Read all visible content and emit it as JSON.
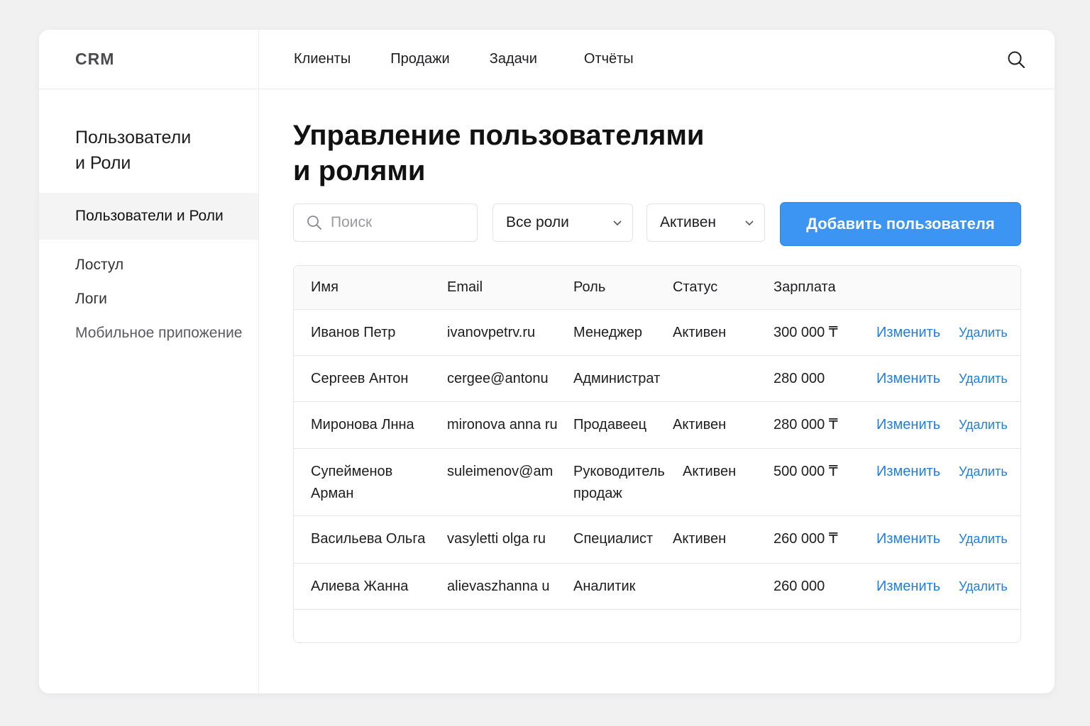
{
  "app": {
    "brand": "CRM"
  },
  "sidebar": {
    "heading_line1": "Пользователи",
    "heading_line2": "и Роли",
    "items": [
      {
        "label": "Пользователи и Роли",
        "active": true
      },
      {
        "label": "Лостул"
      },
      {
        "label": "Логи"
      },
      {
        "label": "Мобильное припожение"
      }
    ]
  },
  "topnav": {
    "links": [
      "Клиенты",
      "Продажи",
      "Задачи",
      "Отчёты"
    ],
    "search_icon": "search-icon"
  },
  "page": {
    "title_line1": "Управление пользователями",
    "title_line2": "и ролями"
  },
  "toolbar": {
    "search_placeholder": "Поиск",
    "role_filter": "Все роли",
    "status_filter": "Активен",
    "add_button": "Добавить пользователя"
  },
  "table": {
    "headers": [
      "Имя",
      "Email",
      "Роль",
      "Статус",
      "Зарплата"
    ],
    "rows": [
      {
        "name": "Иванов Петр",
        "email": "ivanovpetrv.ru",
        "role": "Менеджер",
        "status": "Активен",
        "salary": "300 000 ₸",
        "edit": "Изменить",
        "delete": "Удалить"
      },
      {
        "name": "Сергеев Антон",
        "email": "cergee@antonu",
        "role": "Администрат",
        "status": "",
        "salary": "280 000",
        "edit": "Изменить",
        "delete": "Удалить"
      },
      {
        "name": "Миронова Лнна",
        "email": "mironova anna ru",
        "role": "Продавеец",
        "status": "Активен",
        "salary": "280 000 ₸",
        "edit": "Изменить",
        "delete": "Удалить"
      },
      {
        "name": "Супейменов Арман",
        "email": "suleimenov@am",
        "role": "Руководитель продаж",
        "status": "Активен",
        "salary": "500 000 ₸",
        "edit": "Изменить",
        "delete": "Удалить"
      },
      {
        "name": "Васильева Ольга",
        "email": "vasyletti olga ru",
        "role": "Специалист",
        "status": "Активен",
        "salary": "260 000 ₸",
        "edit": "Изменить",
        "delete": "Удалить"
      },
      {
        "name": "Алиева Жанна",
        "email": "alievaszhanna u",
        "role": "Аналитик",
        "status": "",
        "salary": "260 000",
        "edit": "Изменить",
        "delete": "Удалить"
      }
    ]
  },
  "colors": {
    "accent": "#3d95f3",
    "link": "#1f7fe0"
  }
}
